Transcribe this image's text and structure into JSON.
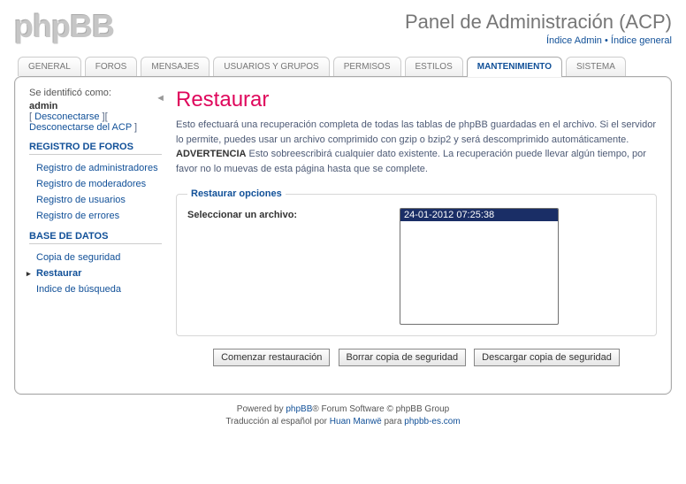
{
  "header": {
    "logo_text": "phpBB",
    "acp_title": "Panel de Administración (ACP)",
    "link_admin": "Índice Admin",
    "link_general": "Índice general",
    "dot": " • "
  },
  "tabs": [
    {
      "label": "GENERAL"
    },
    {
      "label": "FOROS"
    },
    {
      "label": "MENSAJES"
    },
    {
      "label": "USUARIOS Y GRUPOS"
    },
    {
      "label": "PERMISOS"
    },
    {
      "label": "ESTILOS"
    },
    {
      "label": "MANTENIMIENTO",
      "active": true
    },
    {
      "label": "SISTEMA"
    }
  ],
  "login": {
    "identified_as": "Se identificó como:",
    "username": "admin",
    "logout": "Desconectarse",
    "logout_acp": "Desconectarse del ACP",
    "lb": "[ ",
    "rb": " ]",
    "arrow": "◄"
  },
  "sidebar": {
    "group1_title": "REGISTRO DE FOROS",
    "group1_items": [
      {
        "label": "Registro de administradores"
      },
      {
        "label": "Registro de moderadores"
      },
      {
        "label": "Registro de usuarios"
      },
      {
        "label": "Registro de errores"
      }
    ],
    "group2_title": "BASE DE DATOS",
    "group2_items": [
      {
        "label": "Copia de seguridad"
      },
      {
        "label": "Restaurar",
        "active": true
      },
      {
        "label": "Indice de búsqueda"
      }
    ]
  },
  "main": {
    "title": "Restaurar",
    "desc_a": "Esto efectuará una recuperación completa de todas las tablas de phpBB guardadas en el archivo. Si el servidor lo permite, puedes usar un archivo comprimido con gzip o bzip2 y será descomprimido automáticamente. ",
    "desc_warn": "ADVERTENCIA",
    "desc_b": " Esto sobreescribirá cualquier dato existente. La recuperación puede llevar algún tiempo, por favor no lo muevas de esta página hasta que se complete.",
    "legend": "Restaurar opciones",
    "select_label": "Seleccionar un archivo:",
    "files": [
      "24-01-2012 07:25:38"
    ],
    "btn_start": "Comenzar restauración",
    "btn_delete": "Borrar copia de seguridad",
    "btn_download": "Descargar copia de seguridad"
  },
  "footer": {
    "powered_by": "Powered by ",
    "phpbb": "phpBB",
    "forum_sw": "® Forum Software © phpBB Group",
    "translated": "Traducción al español por ",
    "translator": "Huan Manwë",
    "for": " para ",
    "site": "phpbb-es.com"
  }
}
